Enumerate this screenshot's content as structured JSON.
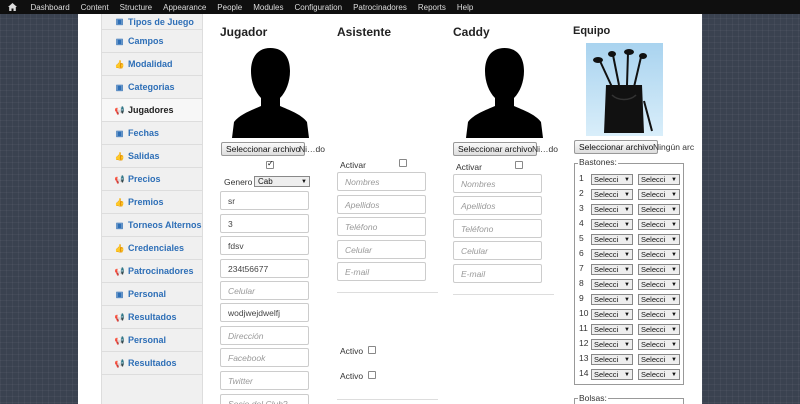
{
  "topbar": {
    "items": [
      "Dashboard",
      "Content",
      "Structure",
      "Appearance",
      "People",
      "Modules",
      "Configuration",
      "Patrocinadores",
      "Reports",
      "Help"
    ]
  },
  "sidebar": {
    "items": [
      {
        "label": "Tipos de Juego",
        "icon": "card-icon"
      },
      {
        "label": "Campos",
        "icon": "card-icon"
      },
      {
        "label": "Modalidad",
        "icon": "thumb-icon"
      },
      {
        "label": "Categorias",
        "icon": "card-icon"
      },
      {
        "label": "Jugadores",
        "icon": "megaphone-icon"
      },
      {
        "label": "Fechas",
        "icon": "card-icon"
      },
      {
        "label": "Salidas",
        "icon": "thumb-icon"
      },
      {
        "label": "Precios",
        "icon": "megaphone-icon"
      },
      {
        "label": "Premios",
        "icon": "thumb-icon"
      },
      {
        "label": "Torneos Alternos",
        "icon": "card-icon"
      },
      {
        "label": "Credenciales",
        "icon": "thumb-icon"
      },
      {
        "label": "Patrocinadores",
        "icon": "megaphone-icon"
      },
      {
        "label": "Personal",
        "icon": "card-icon"
      },
      {
        "label": "Resultados",
        "icon": "megaphone-icon"
      },
      {
        "label": "Personal",
        "icon": "megaphone-icon"
      },
      {
        "label": "Resultados",
        "icon": "megaphone-icon"
      }
    ],
    "active_index": 4
  },
  "jugador": {
    "title": "Jugador",
    "file_button": "Seleccionar archivo",
    "file_name": "Ni…do",
    "genero_label": "Genero",
    "genero_value": "Cab",
    "fields": [
      {
        "value": "sr",
        "placeholder": false
      },
      {
        "value": "3",
        "placeholder": false
      },
      {
        "value": "fdsv",
        "placeholder": false
      },
      {
        "value": "234t56677",
        "placeholder": false
      },
      {
        "value": "Celular",
        "placeholder": true
      },
      {
        "value": "wodjwejdwelfj",
        "placeholder": false
      },
      {
        "value": "Dirección",
        "placeholder": true
      },
      {
        "value": "Facebook",
        "placeholder": true
      },
      {
        "value": "Twitter",
        "placeholder": true
      },
      {
        "value": "Socio del Club?",
        "placeholder": true
      }
    ]
  },
  "asistente": {
    "title": "Asistente",
    "activar_label": "Activar",
    "fields": [
      "Nombres",
      "Apellidos",
      "Teléfono",
      "Celular",
      "E-mail"
    ],
    "activo_label": "Activo"
  },
  "caddy": {
    "title": "Caddy",
    "file_button": "Seleccionar archivo",
    "file_name": "Ni…do",
    "activar_label": "Activar",
    "fields": [
      "Nombres",
      "Apellidos",
      "Teléfono",
      "Celular",
      "E-mail"
    ]
  },
  "equipo": {
    "title": "Equipo",
    "file_button": "Seleccionar archivo",
    "file_name": "Ningún arc",
    "bastones_legend": "Bastones:",
    "bastones_rows": [
      "1",
      "2",
      "3",
      "4",
      "5",
      "6",
      "7",
      "8",
      "9",
      "10",
      "11",
      "12",
      "13",
      "14"
    ],
    "select_label": "Selecci",
    "bolsas_legend": "Bolsas:"
  }
}
